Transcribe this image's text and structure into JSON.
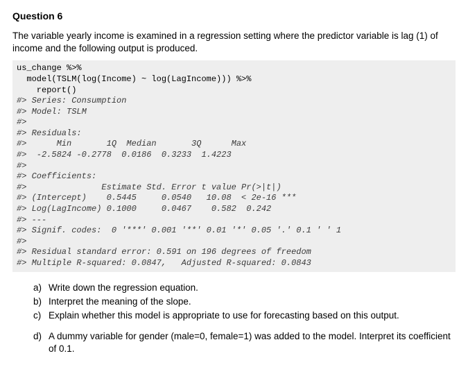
{
  "title": "Question 6",
  "intro": "The variable yearly income is examined in a regression setting where the predictor variable is lag (1) of income and the following output is produced.",
  "code": {
    "l01": "us_change %>%",
    "l02": "  model(TSLM(log(Income) ~ log(LagIncome))) %>%",
    "l03": "    report()",
    "l04": "#> Series: Consumption",
    "l05": "#> Model: TSLM",
    "l06": "#>",
    "l07": "#> Residuals:",
    "l08": "#>      Min       1Q  Median       3Q      Max",
    "l09": "#>  -2.5824 -0.2778  0.0186  0.3233  1.4223",
    "l10": "#>",
    "l11": "#> Coefficients:",
    "l12": "#>               Estimate Std. Error t value Pr(>|t|)",
    "l13": "#> (Intercept)    0.5445     0.0540   10.08  < 2e-16 ***",
    "l14": "#> Log(LagIncome) 0.1000     0.0467    0.582  0.242",
    "l15": "#> ---",
    "l16": "#> Signif. codes:  0 '***' 0.001 '**' 0.01 '*' 0.05 '.' 0.1 ' ' 1",
    "l17": "#>",
    "l18": "#> Residual standard error: 0.591 on 196 degrees of freedom",
    "l19": "#> Multiple R-squared: 0.0847,   Adjusted R-squared: 0.0843"
  },
  "parts": {
    "a": {
      "label": "a)",
      "text": "Write down the regression equation."
    },
    "b": {
      "label": "b)",
      "text": "Interpret the meaning of the slope."
    },
    "c": {
      "label": "c)",
      "text": "Explain whether this model is appropriate to use for forecasting based on this output."
    },
    "d": {
      "label": "d)",
      "text": "A dummy variable for gender (male=0, female=1) was added to the model. Interpret its coefficient of 0.1."
    }
  }
}
